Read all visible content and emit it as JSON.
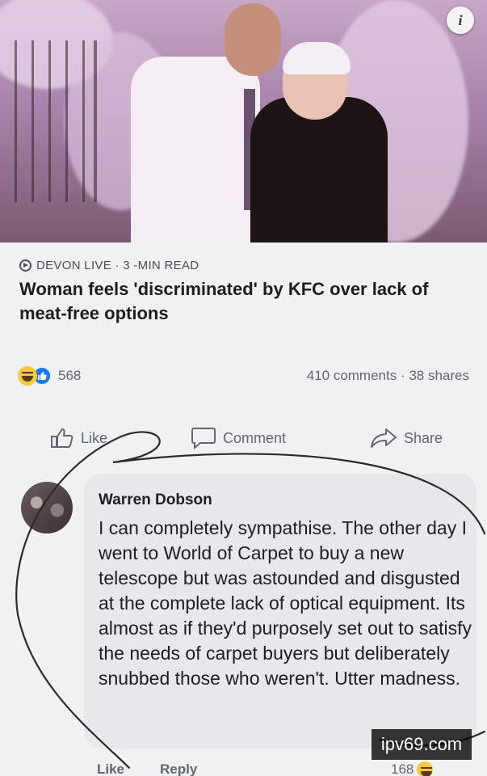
{
  "photo": {
    "info_icon": "info-icon",
    "info_label": "i"
  },
  "article": {
    "source": "DEVON LIVE · 3 -MIN READ",
    "headline": "Woman feels 'discriminated' by KFC over lack of meat-free options"
  },
  "stats": {
    "reaction_count": "568",
    "comments_shares": "410 comments · 38 shares",
    "reaction_icons": [
      "laugh-reaction-icon",
      "like-reaction-icon"
    ]
  },
  "actions": {
    "like": "Like",
    "comment": "Comment",
    "share": "Share"
  },
  "comment": {
    "author": "Warren Dobson",
    "text": "I can completely sympathise. The other day I went to World of Carpet to buy a new telescope but was astounded and disgusted at the complete lack of optical equipment. Its almost as if they'd purposely set out to satisfy the needs of carpet buyers but deliberately snubbed those who weren't. Utter madness.",
    "like": "Like",
    "reply": "Reply",
    "reaction_count": "168"
  },
  "watermark": "ipv69.com",
  "colors": {
    "background": "#f0f1f3",
    "bubble": "#e6e8ec",
    "accent": "#1877f2"
  }
}
